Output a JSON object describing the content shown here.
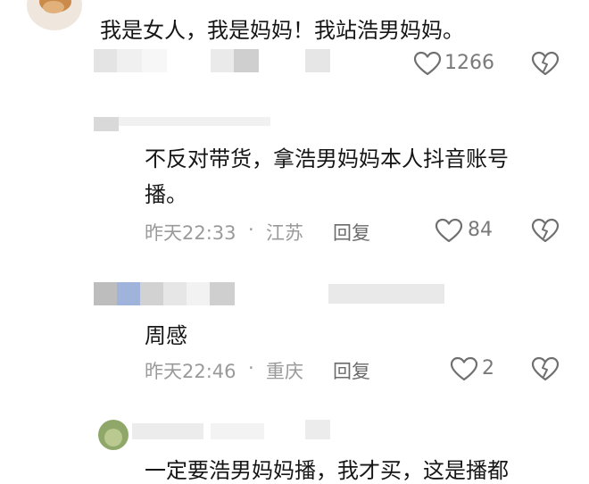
{
  "comments": [
    {
      "text": "我是女人，我是妈妈！我站浩男妈妈。",
      "likes": "1266"
    },
    {
      "text_line1": "不反对带货，拿浩男妈妈本人抖音账号",
      "text_line2": "播。",
      "time": "昨天22:33",
      "separator": "·",
      "location": "江苏",
      "reply": "回复",
      "likes": "84"
    },
    {
      "text": "周感",
      "time": "昨天22:46",
      "separator": "·",
      "location": "重庆",
      "reply": "回复",
      "likes": "2"
    },
    {
      "text": "一定要浩男妈妈播，我才买，这是播都"
    }
  ],
  "icons": {
    "like": "heart-outline-icon",
    "dislike": "broken-heart-icon"
  }
}
